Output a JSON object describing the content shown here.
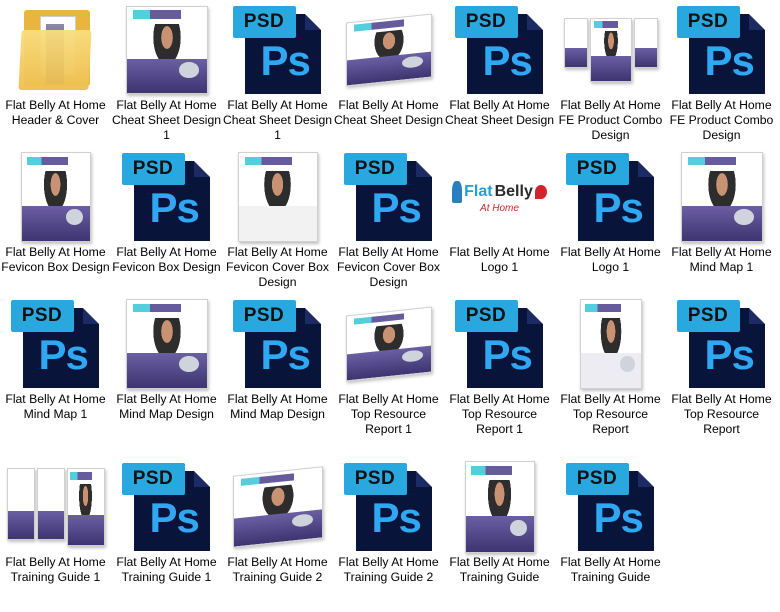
{
  "items": [
    {
      "label": "Flat Belly At Home Header & Cover",
      "icon": "folder-icon"
    },
    {
      "label": "Flat Belly At Home Cheat Sheet Design 1",
      "icon": "product-cover-thumbnail"
    },
    {
      "label": "Flat Belly At Home Cheat Sheet Design 1",
      "icon": "psd-file-icon",
      "tag": "PSD",
      "glyph": "Ps"
    },
    {
      "label": "Flat Belly At Home Cheat Sheet Design",
      "icon": "product-cover-thumbnail"
    },
    {
      "label": "Flat Belly At Home Cheat Sheet Design",
      "icon": "psd-file-icon",
      "tag": "PSD",
      "glyph": "Ps"
    },
    {
      "label": "Flat Belly At Home FE Product Combo Design",
      "icon": "product-combo-thumbnail"
    },
    {
      "label": "Flat Belly At Home FE Product Combo Design",
      "icon": "psd-file-icon",
      "tag": "PSD",
      "glyph": "Ps"
    },
    {
      "label": "Flat Belly At Home Fevicon Box Design",
      "icon": "product-cover-thumbnail"
    },
    {
      "label": "Flat Belly At Home Fevicon Box Design",
      "icon": "psd-file-icon",
      "tag": "PSD",
      "glyph": "Ps"
    },
    {
      "label": "Flat Belly At Home Fevicon Cover Box Design",
      "icon": "product-cover-thumbnail"
    },
    {
      "label": "Flat Belly At Home Fevicon Cover Box Design",
      "icon": "psd-file-icon",
      "tag": "PSD",
      "glyph": "Ps"
    },
    {
      "label": "Flat Belly At Home Logo 1",
      "icon": "logo-thumbnail",
      "logo": {
        "flat": "Flat",
        "belly": "Belly",
        "home": "At Home"
      }
    },
    {
      "label": "Flat Belly At Home Logo 1",
      "icon": "psd-file-icon",
      "tag": "PSD",
      "glyph": "Ps"
    },
    {
      "label": "Flat Belly At Home Mind Map 1",
      "icon": "product-cover-thumbnail"
    },
    {
      "label": "Flat Belly At Home Mind Map 1",
      "icon": "psd-file-icon",
      "tag": "PSD",
      "glyph": "Ps"
    },
    {
      "label": "Flat Belly At Home Mind Map Design",
      "icon": "product-cover-thumbnail"
    },
    {
      "label": "Flat Belly At Home Mind Map Design",
      "icon": "psd-file-icon",
      "tag": "PSD",
      "glyph": "Ps"
    },
    {
      "label": "Flat Belly At Home Top Resource Report 1",
      "icon": "product-cover-thumbnail"
    },
    {
      "label": "Flat Belly At Home Top Resource Report 1",
      "icon": "psd-file-icon",
      "tag": "PSD",
      "glyph": "Ps"
    },
    {
      "label": "Flat Belly At Home Top Resource Report",
      "icon": "product-cover-thumbnail"
    },
    {
      "label": "Flat Belly At Home Top Resource Report",
      "icon": "psd-file-icon",
      "tag": "PSD",
      "glyph": "Ps"
    },
    {
      "label": "Flat Belly At Home Training Guide 1",
      "icon": "product-boxes-thumbnail"
    },
    {
      "label": "Flat Belly At Home Training Guide 1",
      "icon": "psd-file-icon",
      "tag": "PSD",
      "glyph": "Ps"
    },
    {
      "label": "Flat Belly At Home Training Guide 2",
      "icon": "product-cover-thumbnail"
    },
    {
      "label": "Flat Belly At Home Training Guide 2",
      "icon": "psd-file-icon",
      "tag": "PSD",
      "glyph": "Ps"
    },
    {
      "label": "Flat Belly At Home Training Guide",
      "icon": "product-cover-thumbnail"
    },
    {
      "label": "Flat Belly At Home Training Guide",
      "icon": "psd-file-icon",
      "tag": "PSD",
      "glyph": "Ps"
    }
  ],
  "colors": {
    "psd_tag": "#29a8e0",
    "psd_body": "#08143a",
    "ps_glyph": "#2fa7f2",
    "folder": "#e8b53e",
    "cover_band": "#4b3e8a"
  }
}
